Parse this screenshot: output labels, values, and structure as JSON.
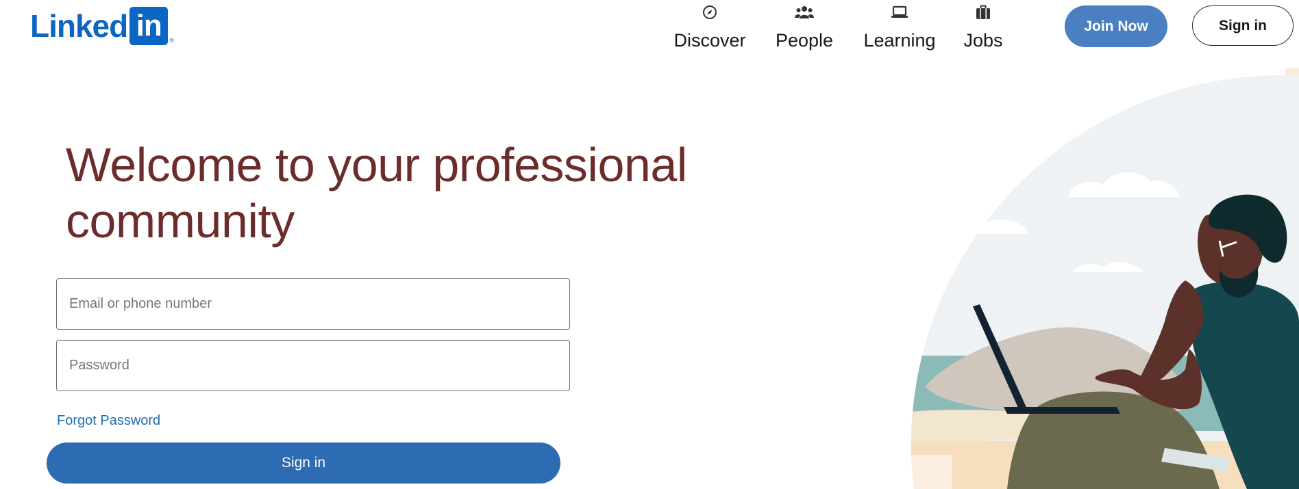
{
  "brand": {
    "wordmark": "Linked",
    "box_text": "in",
    "reg_mark": "®",
    "color": "#0a66c2"
  },
  "nav": {
    "items": [
      {
        "label": "Discover",
        "icon": "compass-icon"
      },
      {
        "label": "People",
        "icon": "people-icon"
      },
      {
        "label": "Learning",
        "icon": "laptop-icon"
      },
      {
        "label": "Jobs",
        "icon": "briefcase-icon"
      }
    ],
    "join_label": "Join Now",
    "signin_label": "Sign in"
  },
  "hero": {
    "headline_line1": "Welcome to your professional",
    "headline_line2": "community",
    "headline_color": "#6b2d2b"
  },
  "form": {
    "email_placeholder": "Email or phone number",
    "password_placeholder": "Password",
    "forgot_label": "Forgot Password",
    "signin_label": "Sign in",
    "button_color": "#2d6bb3"
  },
  "colors": {
    "join_button": "#4a7fc1",
    "link": "#1f6db1"
  }
}
